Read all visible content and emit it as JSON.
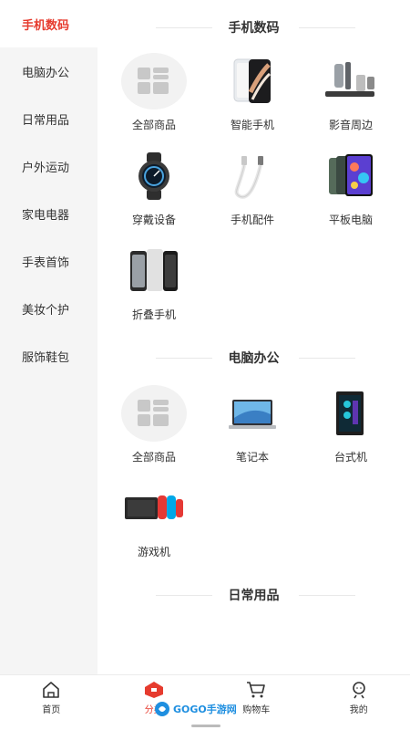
{
  "sidebar": {
    "items": [
      {
        "label": "手机数码",
        "active": true
      },
      {
        "label": "电脑办公"
      },
      {
        "label": "日常用品"
      },
      {
        "label": "户外运动"
      },
      {
        "label": "家电电器"
      },
      {
        "label": "手表首饰"
      },
      {
        "label": "美妆个护"
      },
      {
        "label": "服饰鞋包"
      }
    ]
  },
  "sections": [
    {
      "title": "手机数码",
      "items": [
        "全部商品",
        "智能手机",
        "影音周边",
        "穿戴设备",
        "手机配件",
        "平板电脑",
        "折叠手机"
      ]
    },
    {
      "title": "电脑办公",
      "items": [
        "全部商品",
        "笔记本",
        "台式机",
        "游戏机"
      ]
    },
    {
      "title": "日常用品"
    }
  ],
  "tabbar": {
    "items": [
      {
        "label": "首页",
        "icon": "home-icon"
      },
      {
        "label": "分类",
        "icon": "category-icon",
        "active": true
      },
      {
        "label": "购物车",
        "icon": "cart-icon"
      },
      {
        "label": "我的",
        "icon": "profile-icon"
      }
    ]
  },
  "watermark": {
    "text": "GOGO手游网"
  },
  "colors": {
    "accent": "#e63b2e",
    "sidebar_bg": "#f5f5f5"
  }
}
